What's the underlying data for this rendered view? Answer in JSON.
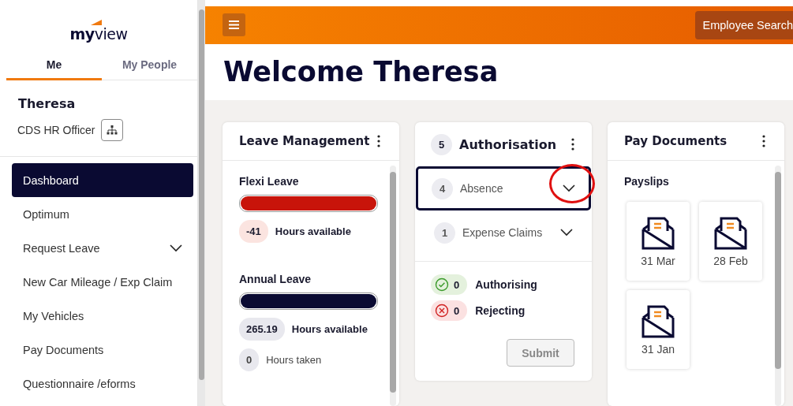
{
  "sidebar": {
    "logo": {
      "prefix": "my",
      "suffix": "view"
    },
    "tabs": [
      {
        "label": "Me",
        "selected": true
      },
      {
        "label": "My People",
        "selected": false
      }
    ],
    "user": {
      "name": "Theresa",
      "role": "CDS HR Officer"
    },
    "items": [
      {
        "label": "Dashboard",
        "selected": true,
        "expandable": false
      },
      {
        "label": "Optimum",
        "selected": false,
        "expandable": false
      },
      {
        "label": "Request Leave",
        "selected": false,
        "expandable": true
      },
      {
        "label": "New Car Mileage / Exp Claim",
        "selected": false,
        "expandable": false
      },
      {
        "label": "My Vehicles",
        "selected": false,
        "expandable": false
      },
      {
        "label": "Pay Documents",
        "selected": false,
        "expandable": false
      },
      {
        "label": "Questionnaire /eforms",
        "selected": false,
        "expandable": false
      }
    ]
  },
  "header": {
    "search_button": "Employee Search"
  },
  "page_title": "Welcome Theresa",
  "leave_card": {
    "title": "Leave Management",
    "sections": [
      {
        "title": "Flexi Leave",
        "level": 1,
        "color": "#c8140a",
        "stats": [
          {
            "value": "-41",
            "label": "Hours available",
            "kind": "negative"
          }
        ]
      },
      {
        "title": "Annual Leave",
        "level": 1,
        "color": "#0a0a32",
        "stats": [
          {
            "value": "265.19",
            "label": "Hours available",
            "kind": "neutral"
          },
          {
            "value": "0",
            "label": "Hours taken",
            "kind": "minor"
          }
        ]
      }
    ]
  },
  "auth_card": {
    "count": "5",
    "title": "Authorisation",
    "groups": [
      {
        "count": "4",
        "label": "Absence",
        "selected": true,
        "highlighted": true
      },
      {
        "count": "1",
        "label": "Expense Claims",
        "selected": false,
        "highlighted": false
      }
    ],
    "actions": [
      {
        "kind": "approve",
        "count": "0",
        "label": "Authorising"
      },
      {
        "kind": "reject",
        "count": "0",
        "label": "Rejecting"
      }
    ],
    "submit": {
      "label": "Submit",
      "disabled": true
    }
  },
  "pay_card": {
    "title": "Pay Documents",
    "section": "Payslips",
    "payslips": [
      "31 Mar",
      "28 Feb",
      "31 Jan"
    ]
  }
}
